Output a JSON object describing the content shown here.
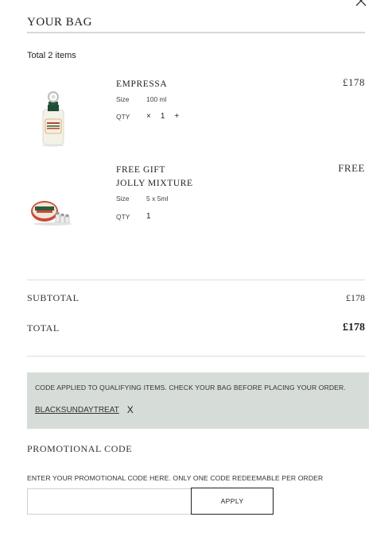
{
  "bag": {
    "title": "YOUR BAG",
    "total_items": "Total 2 items"
  },
  "items": [
    {
      "name_line1": "EMPRESSA",
      "name_line2": "",
      "price": "£178",
      "size_label": "Size",
      "size_value": "100 ml",
      "qty_label": "QTY",
      "qty_minus": "×",
      "qty_value": "1",
      "qty_plus": "+"
    },
    {
      "name_line1": "FREE GIFT",
      "name_line2": "JOLLY MIXTURE",
      "price": "FREE",
      "size_label": "Size",
      "size_value": "5 x 5ml",
      "qty_label": "QTY",
      "qty_value": "1"
    }
  ],
  "summary": {
    "subtotal_label": "SUBTOTAL",
    "subtotal_value": "£178",
    "total_label": "TOTAL",
    "total_value": "£178"
  },
  "promo": {
    "applied_message": "CODE APPLIED TO QUALIFYING ITEMS. CHECK YOUR BAG BEFORE PLACING YOUR ORDER.",
    "applied_code": "BLACKSUNDAYTREAT",
    "remove_glyph": "X",
    "section_title": "PROMOTIONAL CODE",
    "note": "ENTER YOUR PROMOTIONAL CODE HERE. ONLY ONE CODE REDEEMABLE PER ORDER",
    "input_value": "",
    "apply_label": "APPLY"
  },
  "colors": {
    "promo_banner_bg": "#d6ddd8",
    "text": "#222222",
    "rule": "#dcdcdc"
  }
}
